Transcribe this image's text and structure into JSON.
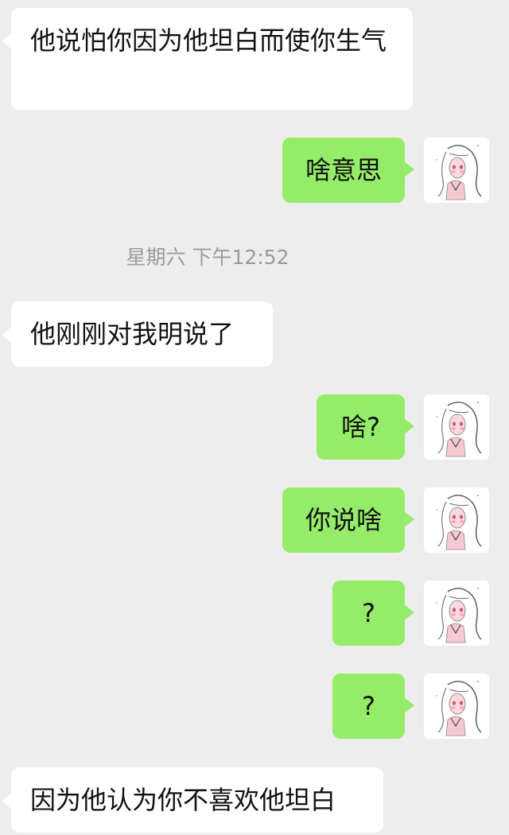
{
  "conversation": {
    "timestamp": "星期六 下午12:52",
    "messages": [
      {
        "side": "in",
        "text": "他说怕你因为他坦白而使你生气"
      },
      {
        "side": "out",
        "text": "啥意思",
        "avatar_icon": "anime-girl-avatar-icon"
      },
      {
        "side": "in",
        "text": "他刚刚对我明说了"
      },
      {
        "side": "out",
        "text": "啥?",
        "avatar_icon": "anime-girl-avatar-icon"
      },
      {
        "side": "out",
        "text": "你说啥",
        "avatar_icon": "anime-girl-avatar-icon"
      },
      {
        "side": "out",
        "text": "?",
        "avatar_icon": "anime-girl-avatar-icon"
      },
      {
        "side": "out",
        "text": "?",
        "avatar_icon": "anime-girl-avatar-icon"
      },
      {
        "side": "in",
        "text": "因为他认为你不喜欢他坦白"
      }
    ]
  },
  "colors": {
    "background": "#ededed",
    "incoming_bubble": "#ffffff",
    "outgoing_bubble": "#95ec69",
    "timestamp_text": "#9b9b9b"
  }
}
